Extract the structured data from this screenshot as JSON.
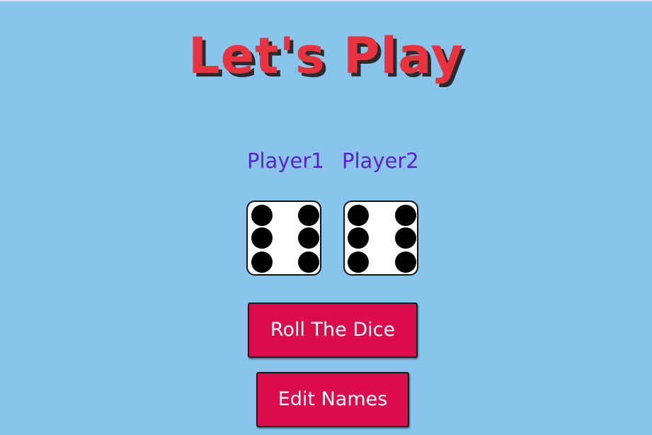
{
  "title": "Let's Play",
  "players": [
    {
      "name": "Player1",
      "die_value": 6
    },
    {
      "name": "Player2",
      "die_value": 6
    }
  ],
  "buttons": {
    "roll_label": "Roll The Dice",
    "edit_label": "Edit Names"
  },
  "colors": {
    "background": "#88c4ec",
    "title": "#e8333f",
    "player_name": "#5c22c9",
    "button": "#dc0c4c"
  }
}
